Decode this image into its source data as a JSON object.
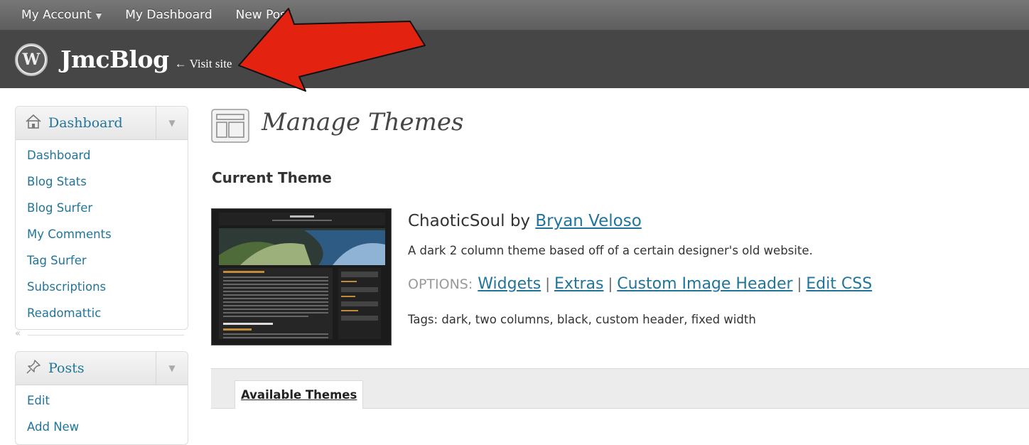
{
  "admin_bar": {
    "my_account": "My Account",
    "my_dashboard": "My Dashboard",
    "new_post": "New Post"
  },
  "site_header": {
    "blog_name": "JmcBlog",
    "visit_site": "← Visit site"
  },
  "sidebar": {
    "dashboard_menu": {
      "title": "Dashboard",
      "items": [
        {
          "label": "Dashboard"
        },
        {
          "label": "Blog Stats"
        },
        {
          "label": "Blog Surfer"
        },
        {
          "label": "My Comments"
        },
        {
          "label": "Tag Surfer"
        },
        {
          "label": "Subscriptions"
        },
        {
          "label": "Readomattic"
        }
      ]
    },
    "collapse_glyph": "«",
    "posts_menu": {
      "title": "Posts",
      "items": [
        {
          "label": "Edit"
        },
        {
          "label": "Add New"
        }
      ]
    }
  },
  "main": {
    "page_title": "Manage Themes",
    "current_theme_heading": "Current Theme",
    "theme": {
      "name": "ChaoticSoul",
      "by": "by",
      "author": "Bryan Veloso",
      "description": "A dark 2 column theme based off of a certain designer's old website.",
      "options_label": "OPTIONS:",
      "options": [
        "Widgets",
        "Extras",
        "Custom Image Header",
        "Edit CSS"
      ],
      "tags": "Tags: dark, two columns, black, custom header, fixed width"
    },
    "available_themes_tab": "Available Themes"
  },
  "colors": {
    "link": "#21759b",
    "header_bg": "#464646",
    "admin_bar_bg": "#6a6a6a",
    "annotation_arrow": "#e3230f"
  },
  "icons": [
    "wordpress-logo-icon",
    "house-icon",
    "pushpin-icon",
    "themes-page-icon",
    "triangle-down-icon"
  ]
}
